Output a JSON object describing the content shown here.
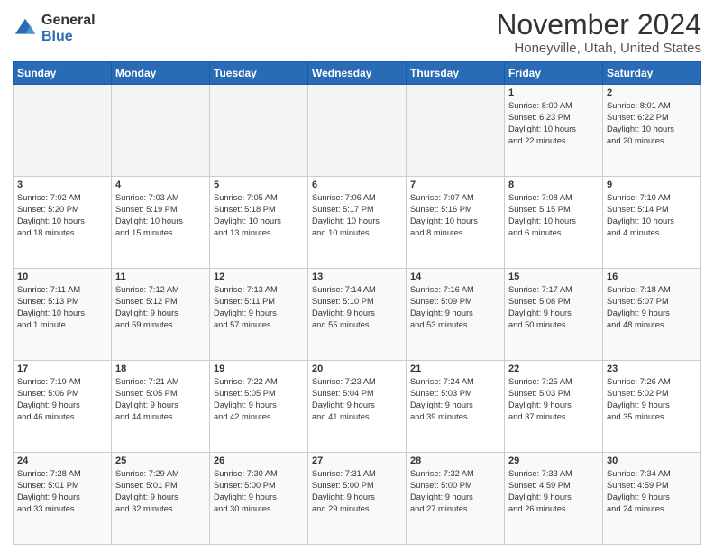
{
  "logo": {
    "general": "General",
    "blue": "Blue"
  },
  "title": "November 2024",
  "location": "Honeyville, Utah, United States",
  "days_of_week": [
    "Sunday",
    "Monday",
    "Tuesday",
    "Wednesday",
    "Thursday",
    "Friday",
    "Saturday"
  ],
  "weeks": [
    [
      {
        "day": "",
        "text": ""
      },
      {
        "day": "",
        "text": ""
      },
      {
        "day": "",
        "text": ""
      },
      {
        "day": "",
        "text": ""
      },
      {
        "day": "",
        "text": ""
      },
      {
        "day": "1",
        "text": "Sunrise: 8:00 AM\nSunset: 6:23 PM\nDaylight: 10 hours\nand 22 minutes."
      },
      {
        "day": "2",
        "text": "Sunrise: 8:01 AM\nSunset: 6:22 PM\nDaylight: 10 hours\nand 20 minutes."
      }
    ],
    [
      {
        "day": "3",
        "text": "Sunrise: 7:02 AM\nSunset: 5:20 PM\nDaylight: 10 hours\nand 18 minutes."
      },
      {
        "day": "4",
        "text": "Sunrise: 7:03 AM\nSunset: 5:19 PM\nDaylight: 10 hours\nand 15 minutes."
      },
      {
        "day": "5",
        "text": "Sunrise: 7:05 AM\nSunset: 5:18 PM\nDaylight: 10 hours\nand 13 minutes."
      },
      {
        "day": "6",
        "text": "Sunrise: 7:06 AM\nSunset: 5:17 PM\nDaylight: 10 hours\nand 10 minutes."
      },
      {
        "day": "7",
        "text": "Sunrise: 7:07 AM\nSunset: 5:16 PM\nDaylight: 10 hours\nand 8 minutes."
      },
      {
        "day": "8",
        "text": "Sunrise: 7:08 AM\nSunset: 5:15 PM\nDaylight: 10 hours\nand 6 minutes."
      },
      {
        "day": "9",
        "text": "Sunrise: 7:10 AM\nSunset: 5:14 PM\nDaylight: 10 hours\nand 4 minutes."
      }
    ],
    [
      {
        "day": "10",
        "text": "Sunrise: 7:11 AM\nSunset: 5:13 PM\nDaylight: 10 hours\nand 1 minute."
      },
      {
        "day": "11",
        "text": "Sunrise: 7:12 AM\nSunset: 5:12 PM\nDaylight: 9 hours\nand 59 minutes."
      },
      {
        "day": "12",
        "text": "Sunrise: 7:13 AM\nSunset: 5:11 PM\nDaylight: 9 hours\nand 57 minutes."
      },
      {
        "day": "13",
        "text": "Sunrise: 7:14 AM\nSunset: 5:10 PM\nDaylight: 9 hours\nand 55 minutes."
      },
      {
        "day": "14",
        "text": "Sunrise: 7:16 AM\nSunset: 5:09 PM\nDaylight: 9 hours\nand 53 minutes."
      },
      {
        "day": "15",
        "text": "Sunrise: 7:17 AM\nSunset: 5:08 PM\nDaylight: 9 hours\nand 50 minutes."
      },
      {
        "day": "16",
        "text": "Sunrise: 7:18 AM\nSunset: 5:07 PM\nDaylight: 9 hours\nand 48 minutes."
      }
    ],
    [
      {
        "day": "17",
        "text": "Sunrise: 7:19 AM\nSunset: 5:06 PM\nDaylight: 9 hours\nand 46 minutes."
      },
      {
        "day": "18",
        "text": "Sunrise: 7:21 AM\nSunset: 5:05 PM\nDaylight: 9 hours\nand 44 minutes."
      },
      {
        "day": "19",
        "text": "Sunrise: 7:22 AM\nSunset: 5:05 PM\nDaylight: 9 hours\nand 42 minutes."
      },
      {
        "day": "20",
        "text": "Sunrise: 7:23 AM\nSunset: 5:04 PM\nDaylight: 9 hours\nand 41 minutes."
      },
      {
        "day": "21",
        "text": "Sunrise: 7:24 AM\nSunset: 5:03 PM\nDaylight: 9 hours\nand 39 minutes."
      },
      {
        "day": "22",
        "text": "Sunrise: 7:25 AM\nSunset: 5:03 PM\nDaylight: 9 hours\nand 37 minutes."
      },
      {
        "day": "23",
        "text": "Sunrise: 7:26 AM\nSunset: 5:02 PM\nDaylight: 9 hours\nand 35 minutes."
      }
    ],
    [
      {
        "day": "24",
        "text": "Sunrise: 7:28 AM\nSunset: 5:01 PM\nDaylight: 9 hours\nand 33 minutes."
      },
      {
        "day": "25",
        "text": "Sunrise: 7:29 AM\nSunset: 5:01 PM\nDaylight: 9 hours\nand 32 minutes."
      },
      {
        "day": "26",
        "text": "Sunrise: 7:30 AM\nSunset: 5:00 PM\nDaylight: 9 hours\nand 30 minutes."
      },
      {
        "day": "27",
        "text": "Sunrise: 7:31 AM\nSunset: 5:00 PM\nDaylight: 9 hours\nand 29 minutes."
      },
      {
        "day": "28",
        "text": "Sunrise: 7:32 AM\nSunset: 5:00 PM\nDaylight: 9 hours\nand 27 minutes."
      },
      {
        "day": "29",
        "text": "Sunrise: 7:33 AM\nSunset: 4:59 PM\nDaylight: 9 hours\nand 26 minutes."
      },
      {
        "day": "30",
        "text": "Sunrise: 7:34 AM\nSunset: 4:59 PM\nDaylight: 9 hours\nand 24 minutes."
      }
    ]
  ]
}
